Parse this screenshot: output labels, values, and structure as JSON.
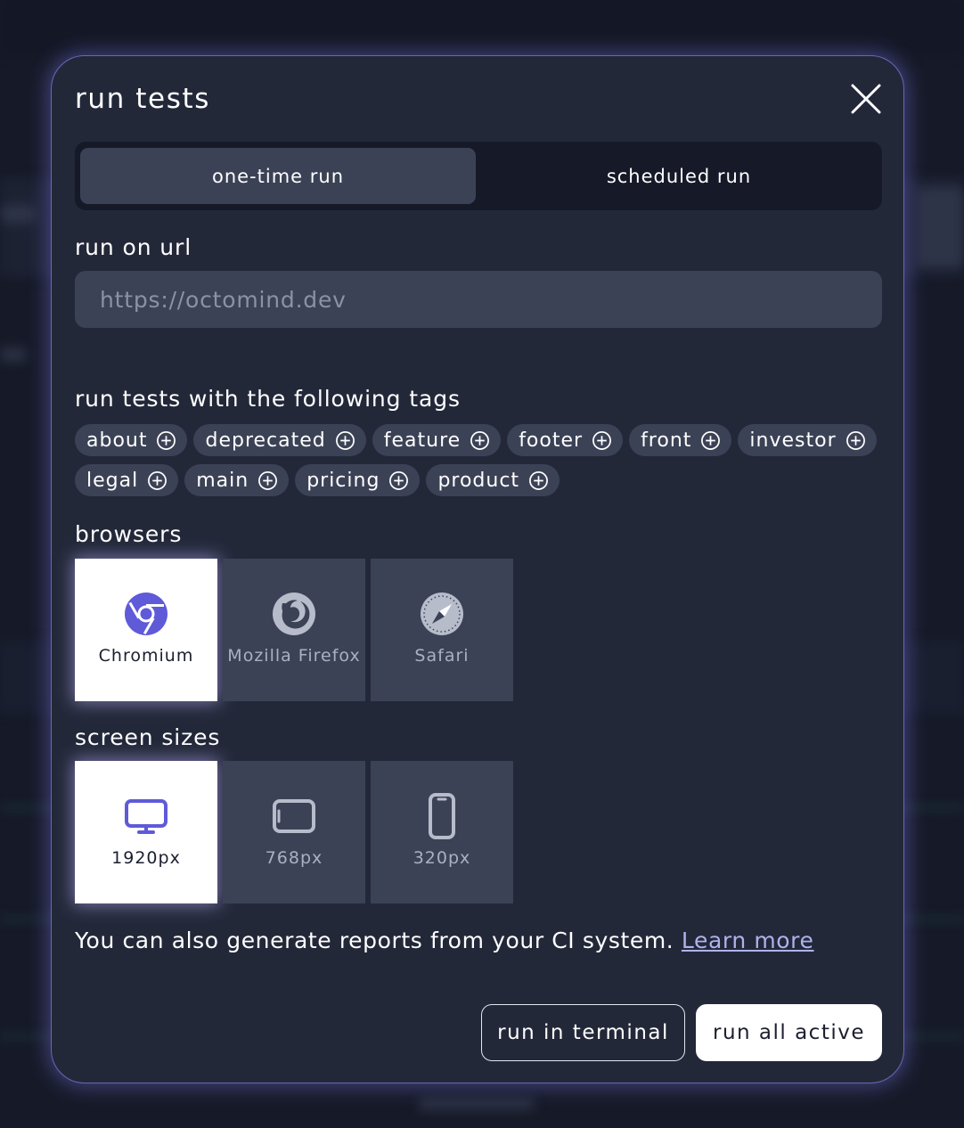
{
  "dialog": {
    "title": "run tests",
    "close_icon": "close-icon"
  },
  "run_mode": {
    "tabs": [
      {
        "label": "one-time run",
        "active": true
      },
      {
        "label": "scheduled run",
        "active": false
      }
    ]
  },
  "url": {
    "label": "run on url",
    "placeholder": "https://octomind.dev",
    "value": ""
  },
  "tags": {
    "label": "run tests with the following tags",
    "add_icon": "plus-circle-icon",
    "items": [
      "about",
      "deprecated",
      "feature",
      "footer",
      "front",
      "investor",
      "legal",
      "main",
      "pricing",
      "product"
    ]
  },
  "browsers": {
    "label": "browsers",
    "items": [
      {
        "label": "Chromium",
        "icon": "chromium-icon",
        "selected": true
      },
      {
        "label": "Mozilla Firefox",
        "icon": "firefox-icon",
        "selected": false
      },
      {
        "label": "Safari",
        "icon": "safari-icon",
        "selected": false
      }
    ]
  },
  "screen_sizes": {
    "label": "screen sizes",
    "items": [
      {
        "label": "1920px",
        "icon": "desktop-icon",
        "selected": true
      },
      {
        "label": "768px",
        "icon": "tablet-icon",
        "selected": false
      },
      {
        "label": "320px",
        "icon": "phone-icon",
        "selected": false
      }
    ]
  },
  "ci_note": {
    "text": "You can also generate reports from your CI system.",
    "link": "Learn more"
  },
  "actions": {
    "terminal_label": "run in terminal",
    "run_all_label": "run all active"
  },
  "colors": {
    "dialog_bg": "#232839",
    "accent": "#5f5ad8",
    "tile_bg": "#3c4256",
    "selected_tile_bg": "#ffffff",
    "link": "#aeb2ea"
  }
}
